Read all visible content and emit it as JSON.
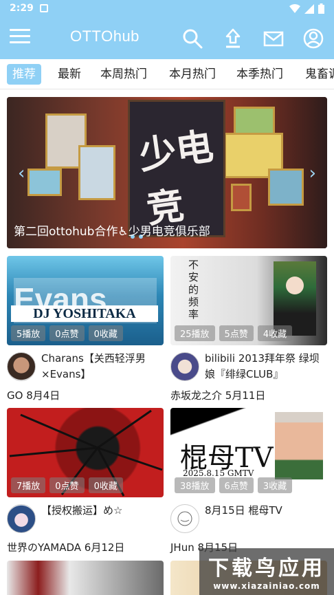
{
  "status_bar": {
    "time": "2:29"
  },
  "app_bar": {
    "title": "OTTOhub"
  },
  "tabs": [
    {
      "label": "推荐",
      "active": true
    },
    {
      "label": "最新"
    },
    {
      "label": "本周热门"
    },
    {
      "label": "本月热门"
    },
    {
      "label": "本季热门"
    },
    {
      "label": "鬼畜调"
    }
  ],
  "banner": {
    "caption": "第二回ottohub合作♿少男电竞俱乐部",
    "poster_text": "少电竞"
  },
  "videos": [
    {
      "thumb_text": "Evans",
      "thumb_subtext": "DJ YOSHITAKA",
      "plays": "5播放",
      "likes": "0点赞",
      "favs": "0收藏",
      "title": "Charans【关西轻浮男×Evans】",
      "author": "GO",
      "date": "8月4日"
    },
    {
      "thumb_text": "不安的频率",
      "plays": "25播放",
      "likes": "5点赞",
      "favs": "4收藏",
      "title": "bilibili 2013拜年祭 绿坝娘『绯绿CLUB』",
      "author": "赤坂龙之介",
      "date": "5月11日"
    },
    {
      "plays": "7播放",
      "likes": "0点赞",
      "favs": "0收藏",
      "title": "【授权搬运】め☆",
      "author": "世界のYAMADA",
      "date": "6月12日"
    },
    {
      "thumb_text": "棍母TV",
      "thumb_subtext": "2025.8.15 GMTV",
      "plays": "38播放",
      "likes": "6点赞",
      "favs": "3收藏",
      "title": "8月15日 棍母TV",
      "author": "JHun",
      "date": "8月15日"
    }
  ],
  "watermark": {
    "big": "下载鸟应用",
    "small": "www.xiazainiao.com"
  },
  "colors": {
    "accent": "#8fd0f5"
  }
}
